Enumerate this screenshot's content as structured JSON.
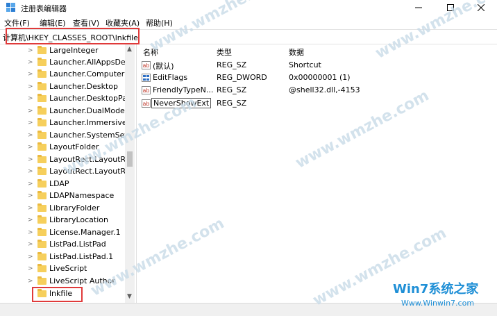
{
  "window": {
    "title": "注册表编辑器",
    "minimize": "—",
    "maximize": "☐",
    "close": "✕"
  },
  "menu": [
    "文件(F)",
    "编辑(E)",
    "查看(V)",
    "收藏夹(A)",
    "帮助(H)"
  ],
  "address": "计算机\\HKEY_CLASSES_ROOT\\lnkfile",
  "tree": [
    "LargeInteger",
    "Launcher.AllAppsDesl",
    "Launcher.Computer",
    "Launcher.Desktop",
    "Launcher.DesktopPac",
    "Launcher.DualModeA",
    "Launcher.ImmersiveA",
    "Launcher.SystemSetti",
    "LayoutFolder",
    "LayoutRect.LayoutRec",
    "LayoutRect.LayoutRec",
    "LDAP",
    "LDAPNamespace",
    "LibraryFolder",
    "LibraryLocation",
    "License.Manager.1",
    "ListPad.ListPad",
    "ListPad.ListPad.1",
    "LiveScript",
    "LiveScript Author",
    "lnkfile"
  ],
  "columns": {
    "name": "名称",
    "type": "类型",
    "data": "数据"
  },
  "values": [
    {
      "icon": "string-value-icon",
      "name": "(默认)",
      "type": "REG_SZ",
      "data": "Shortcut"
    },
    {
      "icon": "dword-value-icon",
      "name": "EditFlags",
      "type": "REG_DWORD",
      "data": "0x00000001 (1)"
    },
    {
      "icon": "string-value-icon",
      "name": "FriendlyTypeN...",
      "type": "REG_SZ",
      "data": "@shell32.dll,-4153"
    },
    {
      "icon": "string-value-icon",
      "name": "NeverShowExt",
      "type": "REG_SZ",
      "data": ""
    }
  ],
  "watermark": "www.wmzhe.com",
  "logo": {
    "top": "Win7系统之家",
    "bottom": "Www.Winwin7.com"
  },
  "colors": {
    "highlight": "#e03a3a",
    "folder": "#f6cf5c",
    "watermark": "#c9dbe8",
    "logo": "#1f8fd6"
  }
}
